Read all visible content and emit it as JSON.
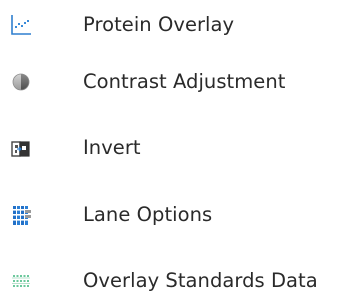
{
  "menu": {
    "items": [
      {
        "label": "Protein Overlay",
        "icon": "scatter-plot-icon"
      },
      {
        "label": "Contrast Adjustment",
        "icon": "contrast-icon"
      },
      {
        "label": "Invert",
        "icon": "invert-icon"
      },
      {
        "label": "Lane Options",
        "icon": "lane-grid-icon"
      },
      {
        "label": "Overlay Standards Data",
        "icon": "standards-lines-icon"
      }
    ]
  },
  "colors": {
    "text": "#2a2a2a",
    "accent_blue": "#2d7fd0",
    "standards_green": "#39b27a"
  }
}
